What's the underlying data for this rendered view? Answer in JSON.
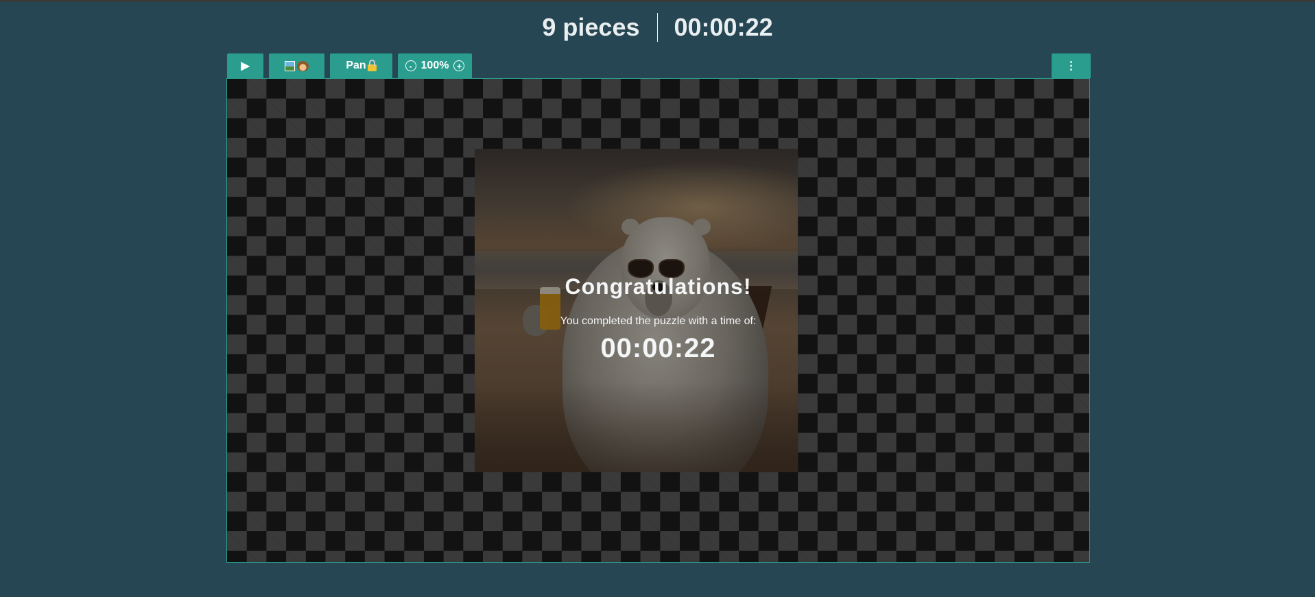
{
  "header": {
    "pieces_label": "9 pieces",
    "timer": "00:00:22"
  },
  "toolbar": {
    "play_label": "▶",
    "preview_icons": [
      "picture-icon",
      "see-no-evil-monkey-icon"
    ],
    "pan_label": "Pan",
    "pan_lock_icon": "lock-icon",
    "zoom_out_label": "-",
    "zoom_level": "100%",
    "zoom_in_label": "+",
    "more_label": "⋮"
  },
  "board": {
    "background": "checkerboard",
    "puzzle_image": "polar-bear-with-sunglasses-and-beer-on-beach"
  },
  "completion": {
    "title": "Congratulations!",
    "message": "You completed the puzzle with a time of:",
    "time": "00:00:22"
  },
  "colors": {
    "page_background": "#264653",
    "button": "#2a9d8f",
    "text": "#e9eef0"
  }
}
